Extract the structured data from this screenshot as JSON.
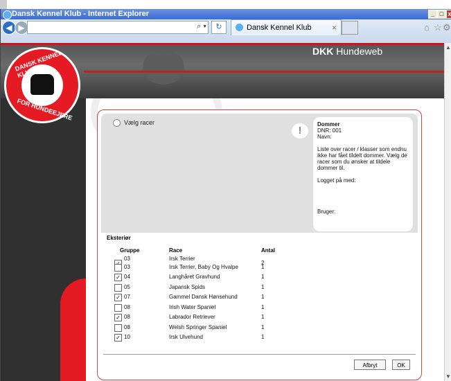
{
  "window": {
    "title": "Dansk Kennel Klub - Internet Explorer",
    "tab": "Dansk Kennel Klub"
  },
  "banner": {
    "brand_bold": "DKK",
    "brand_rest": " Hundeweb"
  },
  "logo": {
    "top_text": "DANSK KENNEL KLUB",
    "bottom_text": "FOR HUNDEEJERE"
  },
  "dialog": {
    "step_label": "Vælg racer",
    "info": {
      "heading": "Dommer",
      "dnr": "DNR: 001",
      "navn": "Navn:",
      "description": "Liste over racer / klasser som endnu ikke har fået tildelt dommer. Vælg de racer som du ønsker at tildele dommer til.",
      "logged_in": "Logget på med:",
      "bruger": "Bruger:"
    },
    "section": "Eksteriør",
    "columns": {
      "gruppe": "Gruppe",
      "race": "Race",
      "antal": "Antal"
    },
    "rows": [
      {
        "gruppe": "03",
        "race": "Irsk Terrier",
        "antal": "2",
        "checked": true
      },
      {
        "gruppe": "03",
        "race": "Irsk Terrier, Baby Og Hvalpe",
        "antal": "1",
        "checked": false
      },
      {
        "gruppe": "04",
        "race": "Langhåret Gravhund",
        "antal": "1",
        "checked": true
      },
      {
        "gruppe": "05",
        "race": "Japansk Spids",
        "antal": "1",
        "checked": false
      },
      {
        "gruppe": "07",
        "race": "Gammel Dansk Hønsehund",
        "antal": "1",
        "checked": true
      },
      {
        "gruppe": "08",
        "race": "Irish Water Spaniel",
        "antal": "1",
        "checked": false
      },
      {
        "gruppe": "08",
        "race": "Labrador Retriever",
        "antal": "1",
        "checked": true
      },
      {
        "gruppe": "08",
        "race": "Welsh Springer Spaniel",
        "antal": "1",
        "checked": false
      },
      {
        "gruppe": "10",
        "race": "Irsk Ulvehund",
        "antal": "1",
        "checked": true
      }
    ],
    "buttons": {
      "cancel": "Afbryt",
      "ok": "OK"
    }
  },
  "icons": {
    "check": "✓",
    "warn": "!"
  }
}
